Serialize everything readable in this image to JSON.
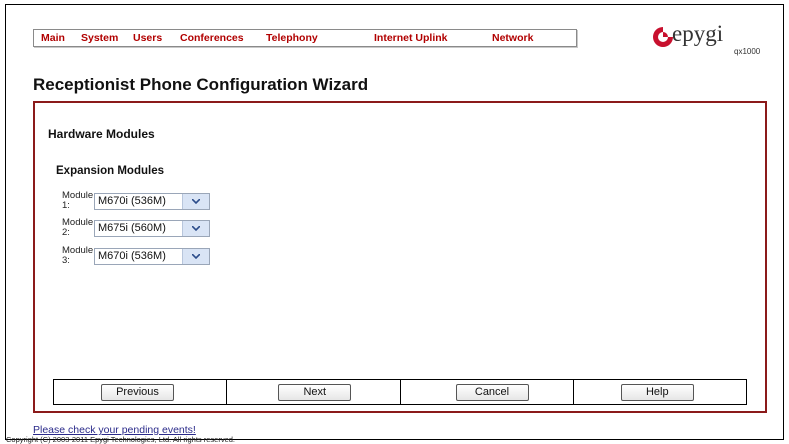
{
  "menu": {
    "items": [
      {
        "label": "Main"
      },
      {
        "label": "System"
      },
      {
        "label": "Users"
      },
      {
        "label": "Conferences"
      },
      {
        "label": "Telephony"
      },
      {
        "label": "Internet Uplink"
      },
      {
        "label": "Network"
      }
    ]
  },
  "logo": {
    "brand": "epygi",
    "model": "qx1000",
    "icon": "epygi-logo-icon",
    "color": "#c8102e"
  },
  "page": {
    "title": "Receptionist Phone Configuration Wizard"
  },
  "hardware": {
    "section_title": "Hardware Modules",
    "subsection_title": "Expansion Modules",
    "modules": [
      {
        "label": "Module 1:",
        "value": "M670i (536M)"
      },
      {
        "label": "Module 2:",
        "value": "M675i (560M)"
      },
      {
        "label": "Module 3:",
        "value": "M670i (536M)"
      }
    ]
  },
  "buttons": {
    "previous": "Previous",
    "next": "Next",
    "cancel": "Cancel",
    "help": "Help"
  },
  "footer": {
    "pending_link": "Please check your pending events!",
    "copyright": "Copyright (C) 2003-2011 Epygi Technologies, Ltd. All rights reserved."
  },
  "colors": {
    "menu_text": "#b10000",
    "box_border": "#8b1a1a"
  }
}
